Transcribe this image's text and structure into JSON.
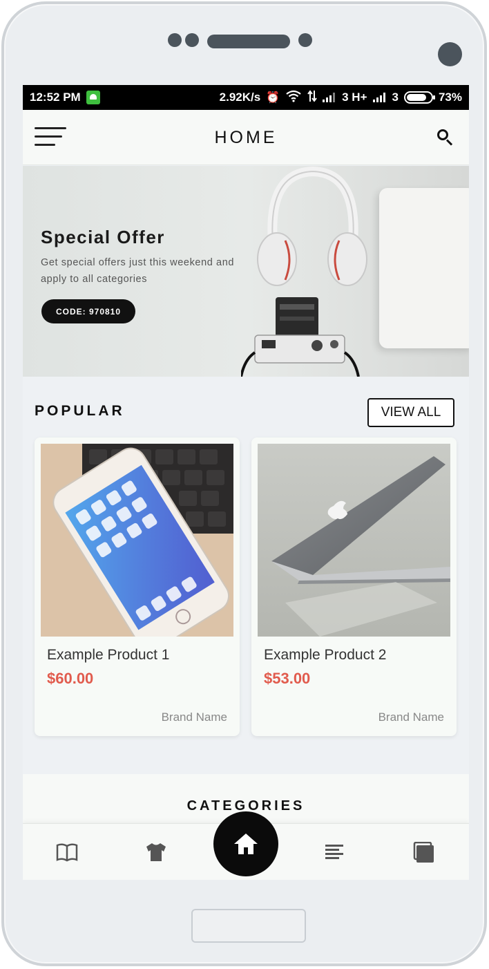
{
  "status_bar": {
    "time": "12:52 PM",
    "network_speed": "2.92K/s",
    "network_type": "3 H+",
    "sim2_label": "3",
    "battery": "73%",
    "icons": [
      "android-notification-icon",
      "alarm-icon",
      "wifi-icon",
      "data-transfer-icon",
      "signal-icon",
      "battery-icon"
    ]
  },
  "app_bar": {
    "title": "HOME",
    "menu_icon": "hamburger-menu-icon",
    "search_icon": "search-icon"
  },
  "banner": {
    "title": "Special Offer",
    "subtitle": "Get special offers just this weekend and apply to all categories",
    "code_label": "CODE: 970810"
  },
  "popular": {
    "title": "POPULAR",
    "view_all_label": "VIEW ALL",
    "products": [
      {
        "name": "Example Product 1",
        "price": "$60.00",
        "brand": "Brand Name",
        "image": "iphone-photo"
      },
      {
        "name": "Example Product 2",
        "price": "$53.00",
        "brand": "Brand Name",
        "image": "macbook-photo"
      }
    ]
  },
  "categories": {
    "title": "CATEGORIES"
  },
  "bottom_nav": {
    "items": [
      "book-icon",
      "tshirt-icon",
      "home-icon",
      "list-icon",
      "layers-icon"
    ],
    "active": "home-icon"
  },
  "colors": {
    "accent_price": "#e15b4d",
    "dark": "#111111",
    "background": "#eef1f4"
  }
}
